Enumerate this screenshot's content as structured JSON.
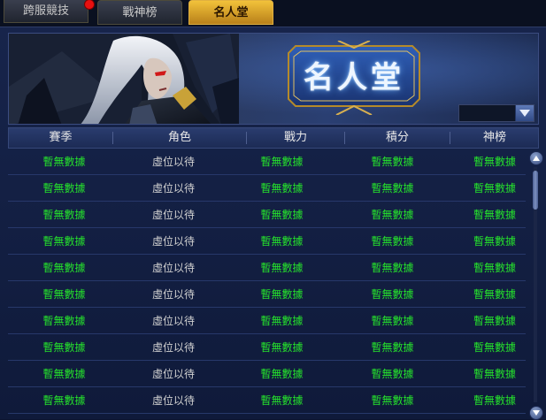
{
  "tabs": [
    {
      "label": "跨服競技",
      "active": false,
      "has_notification": true
    },
    {
      "label": "戰神榜",
      "active": false,
      "has_notification": false
    },
    {
      "label": "名人堂",
      "active": true,
      "has_notification": false
    }
  ],
  "banner": {
    "title": "名人堂",
    "season_dropdown": {
      "value": ""
    }
  },
  "table": {
    "columns": [
      "賽季",
      "角色",
      "戰力",
      "積分",
      "神榜"
    ],
    "rows": [
      [
        "暫無數據",
        "虛位以待",
        "暫無數據",
        "暫無數據",
        "暫無數據"
      ],
      [
        "暫無數據",
        "虛位以待",
        "暫無數據",
        "暫無數據",
        "暫無數據"
      ],
      [
        "暫無數據",
        "虛位以待",
        "暫無數據",
        "暫無數據",
        "暫無數據"
      ],
      [
        "暫無數據",
        "虛位以待",
        "暫無數據",
        "暫無數據",
        "暫無數據"
      ],
      [
        "暫無數據",
        "虛位以待",
        "暫無數據",
        "暫無數據",
        "暫無數據"
      ],
      [
        "暫無數據",
        "虛位以待",
        "暫無數據",
        "暫無數據",
        "暫無數據"
      ],
      [
        "暫無數據",
        "虛位以待",
        "暫無數據",
        "暫無數據",
        "暫無數據"
      ],
      [
        "暫無數據",
        "虛位以待",
        "暫無數據",
        "暫無數據",
        "暫無數據"
      ],
      [
        "暫無數據",
        "虛位以待",
        "暫無數據",
        "暫無數據",
        "暫無數據"
      ],
      [
        "暫無數據",
        "虛位以待",
        "暫無數據",
        "暫無數據",
        "暫無數據"
      ]
    ]
  },
  "colors": {
    "accent_gold": "#f2c23a",
    "data_green": "#25e02c",
    "placeholder_gray": "#d0d0d0",
    "notification_red": "#e81010"
  },
  "icons": [
    "notification-dot-icon",
    "dropdown-arrow-icon",
    "scroll-up-icon",
    "scroll-down-icon"
  ]
}
